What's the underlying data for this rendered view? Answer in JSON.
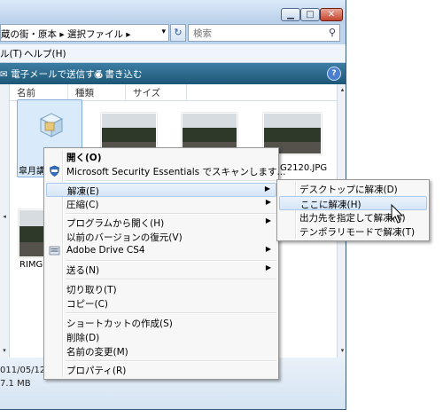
{
  "window": {
    "address_path": "蔵の街・原本 ▸ 選択ファイル ▸",
    "search_placeholder": "検索",
    "menu": {
      "tools": "ル(T)",
      "help": "ヘルプ(H)"
    },
    "toolbar": {
      "email": "電子メールで送信する",
      "burn": "書き込む",
      "help_glyph": "?"
    },
    "columns": {
      "name": "名前",
      "type": "種類",
      "size": "サイズ"
    },
    "files": [
      {
        "label": "皐月講"
      },
      {
        "label": "G2120.JPG"
      },
      {
        "label": "RIMG"
      }
    ],
    "details": {
      "date": "011/05/12",
      "size": "7.1 MB"
    }
  },
  "context_menu": {
    "open": "開く(O)",
    "scan": "Microsoft Security Essentials でスキャンします...",
    "extract": "解凍(E)",
    "compress": "圧縮(C)",
    "open_with": "プログラムから開く(H)",
    "restore": "以前のバージョンの復元(V)",
    "adobe": "Adobe Drive CS4",
    "send_to": "送る(N)",
    "cut": "切り取り(T)",
    "copy": "コピー(C)",
    "shortcut": "ショートカットの作成(S)",
    "delete": "削除(D)",
    "rename": "名前の変更(M)",
    "properties": "プロパティ(R)"
  },
  "submenu": {
    "desktop": "デスクトップに解凍(D)",
    "here": "ここに解凍(H)",
    "choose": "出力先を指定して解凍(S)",
    "temp": "テンポラリモードで解凍(T)"
  },
  "colors": {
    "toolbar": "#1d5776",
    "highlight": "#d5e6f8",
    "selection": "#d9ebfa"
  }
}
